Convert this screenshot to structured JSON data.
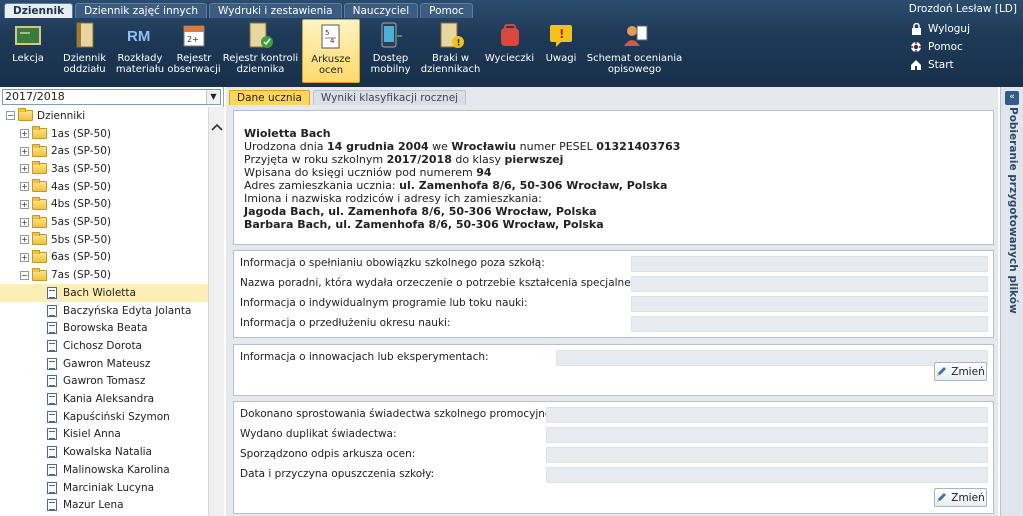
{
  "menu_tabs": [
    {
      "label": "Dziennik",
      "active": true
    },
    {
      "label": "Dziennik zajęć innych",
      "active": false
    },
    {
      "label": "Wydruki i zestawienia",
      "active": false
    },
    {
      "label": "Nauczyciel",
      "active": false
    },
    {
      "label": "Pomoc",
      "active": false
    }
  ],
  "user": "Drozdoń Lesław [LD]",
  "toolbar": [
    {
      "l1": "Lekcja",
      "l2": "",
      "icon": "lesson-icon"
    },
    {
      "l1": "Dziennik",
      "l2": "oddziału",
      "icon": "class-journal-icon"
    },
    {
      "l1": "Rozkłady",
      "l2": "materiału",
      "icon": "rm-icon"
    },
    {
      "l1": "Rejestr",
      "l2": "obserwacji",
      "icon": "observation-register-icon"
    },
    {
      "l1": "Rejestr kontroli",
      "l2": "dziennika",
      "icon": "control-register-icon"
    },
    {
      "l1": "Arkusze",
      "l2": "ocen",
      "icon": "grade-sheets-icon"
    },
    {
      "l1": "Dostęp",
      "l2": "mobilny",
      "icon": "mobile-access-icon"
    },
    {
      "l1": "Braki w",
      "l2": "dziennikach",
      "icon": "journal-gaps-icon"
    },
    {
      "l1": "Wycieczki",
      "l2": "",
      "icon": "trips-icon"
    },
    {
      "l1": "Uwagi",
      "l2": "",
      "icon": "remarks-icon"
    },
    {
      "l1": "Schemat oceniania",
      "l2": "opisowego",
      "icon": "descriptive-grading-icon"
    }
  ],
  "side_links": [
    {
      "label": "Wyloguj",
      "icon": "lock-icon"
    },
    {
      "label": "Pomoc",
      "icon": "lifebuoy-icon"
    },
    {
      "label": "Start",
      "icon": "home-icon"
    }
  ],
  "year": "2017/2018",
  "tree_root": "Dzienniki",
  "classes": [
    "1as (SP-50)",
    "2as (SP-50)",
    "3as (SP-50)",
    "4as (SP-50)",
    "4bs (SP-50)",
    "5as (SP-50)",
    "5bs (SP-50)",
    "6as (SP-50)",
    "7as (SP-50)"
  ],
  "students": [
    "Bach Wioletta",
    "Baczyńska Edyta Jolanta",
    "Borowska Beata",
    "Cichosz Dorota",
    "Gawron Mateusz",
    "Gawron Tomasz",
    "Kania Aleksandra",
    "Kapuściński Szymon",
    "Kisiel Anna",
    "Kowalska Natalia",
    "Malinowska Karolina",
    "Marciniak Lucyna",
    "Mazur Lena"
  ],
  "subtabs": [
    {
      "label": "Dane ucznia",
      "active": true
    },
    {
      "label": "Wyniki klasyfikacji rocznej",
      "active": false
    }
  ],
  "student_info": {
    "name": "Wioletta Bach",
    "born_pre": "Urodzona dnia ",
    "born_date": "14 grudnia 2004",
    "born_mid": " we ",
    "born_place": "Wrocławiu",
    "pesel_pre": " numer PESEL ",
    "pesel": "01321403763",
    "adm_pre": "Przyjęta w roku szkolnym ",
    "adm_year": "2017/2018",
    "adm_mid": " do klasy ",
    "adm_class": "pierwszej",
    "book_pre": "Wpisana do księgi uczniów pod numerem ",
    "book_no": "94",
    "addr_pre": "Adres zamieszkania ucznia: ",
    "addr": "ul. Zamenhofa 8/6, 50-306 Wrocław, Polska",
    "parents_label": "Imiona i nazwiska rodziców i adresy ich zamieszkania:",
    "parent1": "Jagoda Bach, ul. Zamenhofa 8/6, 50-306 Wrocław, Polska",
    "parent2": "Barbara Bach, ul. Zamenhofa 8/6, 50-306 Wrocław, Polska"
  },
  "section2": [
    "Informacja o spełnianiu obowiązku szkolnego poza szkołą:",
    "Nazwa poradni, która wydała orzeczenie o potrzebie kształcenia specjalnego:",
    "Informacja o indywidualnym programie lub toku nauki:",
    "Informacja o przedłużeniu okresu nauki:"
  ],
  "section3": [
    "Informacja o innowacjach lub eksperymentach:"
  ],
  "section4": [
    "Dokonano sprostowania świadectwa szkolnego promocyjnego:",
    "Wydano duplikat świadectwa:",
    "Sporządzono odpis arkusza ocen:",
    "Data i przyczyna opuszczenia szkoły:"
  ],
  "edit_label": "Zmień",
  "right_panel": "Pobieranie przygotowanych plików"
}
